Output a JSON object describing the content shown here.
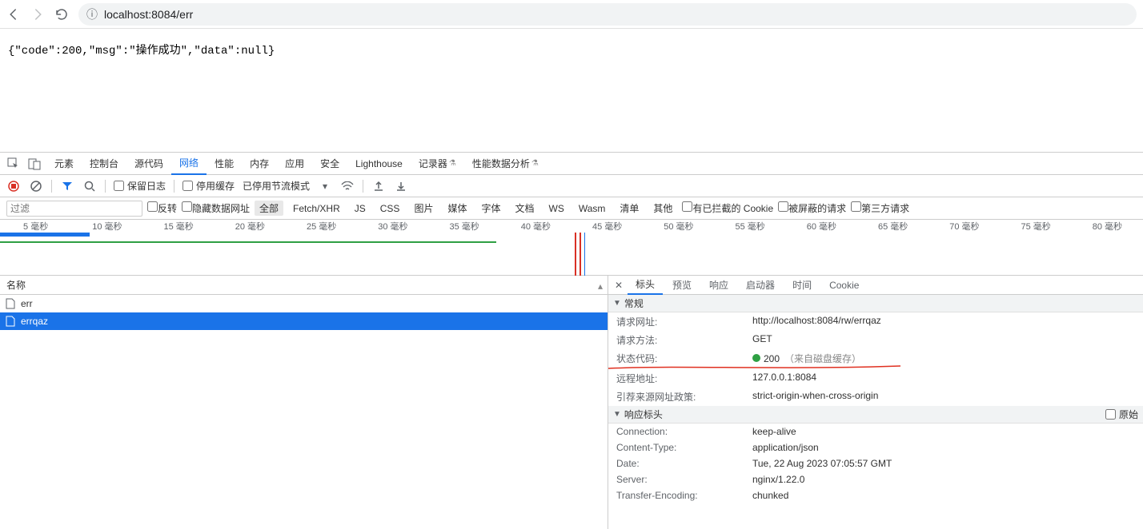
{
  "browser": {
    "url_prefix_icon": "ⓘ",
    "url": "localhost:8084/err"
  },
  "page_content": "{\"code\":200,\"msg\":\"操作成功\",\"data\":null}",
  "devtools_tabs": [
    "元素",
    "控制台",
    "源代码",
    "网络",
    "性能",
    "内存",
    "应用",
    "安全",
    "Lighthouse",
    "记录器",
    "性能数据分析"
  ],
  "devtools_active_tab": "网络",
  "toolbar": {
    "preserve_log": "保留日志",
    "disable_cache": "停用缓存",
    "throttle_status": "已停用节流模式"
  },
  "filterbar": {
    "filter_placeholder": "过滤",
    "invert": "反转",
    "hide_data_urls": "隐藏数据网址",
    "types": [
      "全部",
      "Fetch/XHR",
      "JS",
      "CSS",
      "图片",
      "媒体",
      "字体",
      "文档",
      "WS",
      "Wasm",
      "清单",
      "其他"
    ],
    "blocked_cookies": "有已拦截的 Cookie",
    "blocked_requests": "被屏蔽的请求",
    "third_party": "第三方请求"
  },
  "timeline_ticks": [
    "5 毫秒",
    "10 毫秒",
    "15 毫秒",
    "20 毫秒",
    "25 毫秒",
    "30 毫秒",
    "35 毫秒",
    "40 毫秒",
    "45 毫秒",
    "50 毫秒",
    "55 毫秒",
    "60 毫秒",
    "65 毫秒",
    "70 毫秒",
    "75 毫秒",
    "80 毫秒"
  ],
  "name_header": "名称",
  "requests": [
    {
      "name": "err"
    },
    {
      "name": "errqaz"
    }
  ],
  "detail_tabs": [
    "标头",
    "预览",
    "响应",
    "启动器",
    "时间",
    "Cookie"
  ],
  "general": {
    "title": "常规",
    "rows": {
      "request_url_k": "请求网址:",
      "request_url_v": "http://localhost:8084/rw/errqaz",
      "request_method_k": "请求方法:",
      "request_method_v": "GET",
      "status_code_k": "状态代码:",
      "status_code_v": "200",
      "status_cache": "（来自磁盘缓存）",
      "remote_addr_k": "远程地址:",
      "remote_addr_v": "127.0.0.1:8084",
      "referrer_policy_k": "引荐来源网址政策:",
      "referrer_policy_v": "strict-origin-when-cross-origin"
    }
  },
  "response_headers": {
    "title": "响应标头",
    "raw_label": "原始",
    "rows": [
      {
        "k": "Connection:",
        "v": "keep-alive"
      },
      {
        "k": "Content-Type:",
        "v": "application/json"
      },
      {
        "k": "Date:",
        "v": "Tue, 22 Aug 2023 07:05:57 GMT"
      },
      {
        "k": "Server:",
        "v": "nginx/1.22.0"
      },
      {
        "k": "Transfer-Encoding:",
        "v": "chunked"
      }
    ]
  }
}
